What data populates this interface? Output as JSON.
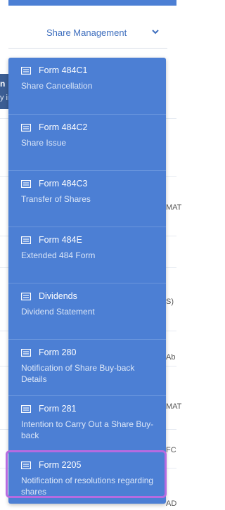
{
  "dropdown": {
    "label": "Share Management",
    "icon": "chevron-down-icon"
  },
  "background": {
    "left_heading_fragment": "n",
    "left_sub_fragment": "y ir",
    "right_fragments": [
      "MAT",
      "S)",
      "Ab",
      "MAT",
      "FC",
      "AD"
    ]
  },
  "menu": {
    "items": [
      {
        "title": "Form 484C1",
        "description": "Share Cancellation",
        "icon": "document-icon"
      },
      {
        "title": "Form 484C2",
        "description": "Share Issue",
        "icon": "document-icon"
      },
      {
        "title": "Form 484C3",
        "description": "Transfer of Shares",
        "icon": "document-icon"
      },
      {
        "title": "Form 484E",
        "description": "Extended 484 Form",
        "icon": "document-icon"
      },
      {
        "title": "Dividends",
        "description": "Dividend Statement",
        "icon": "document-icon"
      },
      {
        "title": "Form 280",
        "description": "Notification of Share Buy-back Details",
        "icon": "document-icon"
      },
      {
        "title": "Form 281",
        "description": "Intention to Carry Out a Share Buy-back",
        "icon": "document-icon"
      },
      {
        "title": "Form 2205",
        "description": "Notification of resolutions regarding shares",
        "icon": "document-icon"
      }
    ]
  },
  "colors": {
    "menu_bg": "#4c7fd4",
    "highlight": "#b66be0",
    "dropdown_text": "#3f6fbe"
  }
}
